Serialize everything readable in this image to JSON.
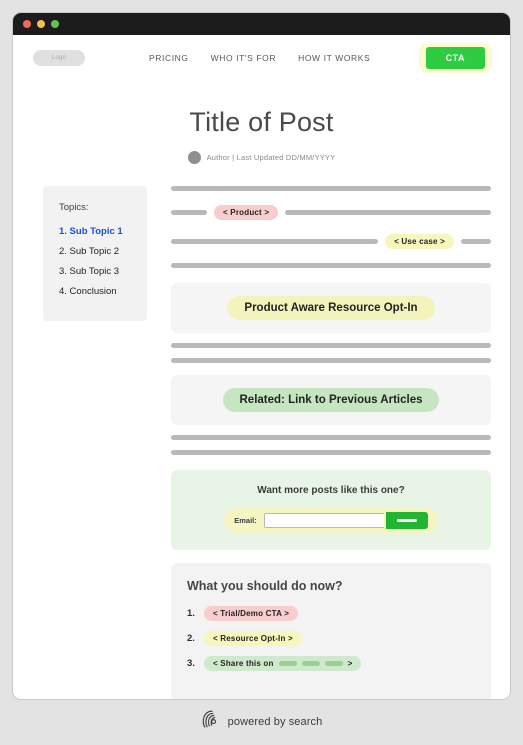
{
  "window": {
    "traffic_lights": [
      "close",
      "minimize",
      "maximize"
    ]
  },
  "nav": {
    "logo_label": "Logo",
    "links": [
      {
        "label": "PRICING"
      },
      {
        "label": "WHO IT'S FOR"
      },
      {
        "label": "HOW IT WORKS"
      }
    ],
    "cta_label": "CTA",
    "cta_color": "#2ecc40",
    "cta_glow_color": "#fbfbcd"
  },
  "article": {
    "title": "Title of Post",
    "meta": "Author | Last Updated DD/MM/YYYY"
  },
  "toc": {
    "heading": "Topics:",
    "items": [
      {
        "label": "1. Sub Topic 1",
        "active": true
      },
      {
        "label": "2. Sub Topic 2",
        "active": false
      },
      {
        "label": "3. Sub Topic 3",
        "active": false
      },
      {
        "label": "4. Conclusion",
        "active": false
      }
    ],
    "active_color": "#1a4fd6"
  },
  "content": {
    "chip_product": "< Product >",
    "chip_usecase": "< Use case >",
    "banner_optin": "Product Aware Resource Opt-In",
    "banner_related": "Related: Link to Previous Articles"
  },
  "optin": {
    "title": "Want more posts like this one?",
    "email_label": "Email:",
    "email_value": "",
    "email_placeholder": "",
    "submit_label": ""
  },
  "do_now": {
    "title": "What you should do now?",
    "items": [
      {
        "num": "1.",
        "label": "< Trial/Demo CTA >",
        "tone": "pink"
      },
      {
        "num": "2.",
        "label": "< Resource Opt-In >",
        "tone": "yellow"
      },
      {
        "num": "3.",
        "label": "< Share this on",
        "tone": "green",
        "suffix": ">",
        "pills": 3
      }
    ]
  },
  "footer": {
    "text": "powered by search",
    "icon": "fingerprint-icon"
  },
  "colors": {
    "page_background": "#e3e3e3",
    "chip_pink": "#f7cdcd",
    "chip_yellow": "#f6f6bd",
    "chip_green": "#cfe9cd",
    "bar_gray": "#b9b9b9",
    "card_gray": "#f3f3f3",
    "optin_green": "#e8f5e6"
  }
}
